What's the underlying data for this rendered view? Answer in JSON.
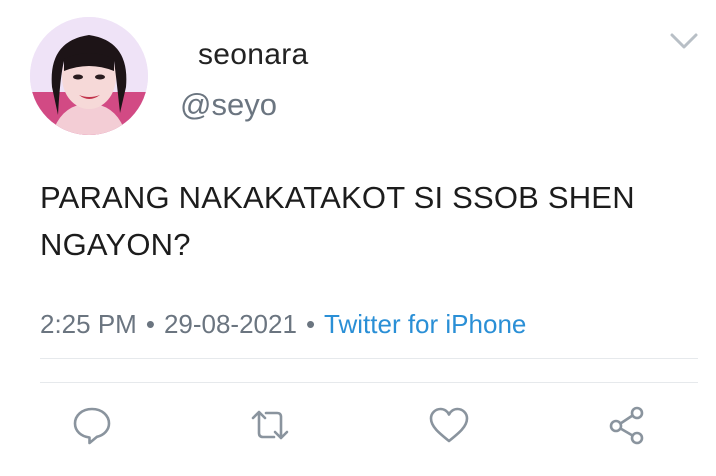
{
  "user": {
    "display_name": "seonara",
    "handle": "@seyo",
    "avatar_icon": "profile-photo"
  },
  "tweet": {
    "text_line1": "PARANG NAKAKATAKOT SI SSOB SHEN",
    "text_line2": "NGAYON?",
    "time": "2:25 PM",
    "date": "29-08-2021",
    "separator": "•",
    "source": "Twitter for iPhone"
  },
  "actions": [
    {
      "name": "reply",
      "icon": "comment-bubble-icon"
    },
    {
      "name": "retweet",
      "icon": "retweet-icon"
    },
    {
      "name": "like",
      "icon": "heart-icon"
    },
    {
      "name": "share",
      "icon": "share-icon"
    }
  ],
  "colors": {
    "text": "#1c1c1c",
    "muted": "#6b7580",
    "link": "#2a8fd6",
    "divider": "#e6e9ec",
    "icon": "#8a949e"
  }
}
